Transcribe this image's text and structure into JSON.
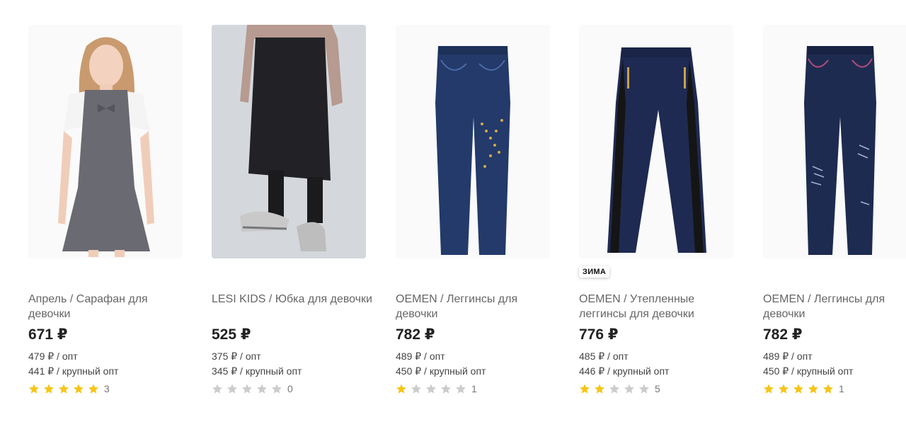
{
  "colors": {
    "star_on": "#f5c518",
    "star_off": "#cccccc"
  },
  "products": [
    {
      "image": "girl-in-gray-sundress-photo",
      "badge": "",
      "title": "Апрель / Сарафан для девочки",
      "price": "671 ₽",
      "opt": "479 ₽ / опт",
      "big_opt": "441 ₽ / крупный опт",
      "rating": 5,
      "reviews": "3"
    },
    {
      "image": "black-skirt-and-sneakers-photo",
      "badge": "",
      "title": "LESI KIDS / Юбка для девочки",
      "price": "525 ₽",
      "opt": "375 ₽ / опт",
      "big_opt": "345 ₽ / крупный опт",
      "rating": 0,
      "reviews": "0"
    },
    {
      "image": "denim-print-leggings-with-studs-photo",
      "badge": "",
      "title": "OEMEN / Леггинсы для девочки",
      "price": "782 ₽",
      "opt": "489 ₽ / опт",
      "big_opt": "450 ₽ / крупный опт",
      "rating": 1,
      "reviews": "1"
    },
    {
      "image": "navy-leggings-with-leather-stripes-photo",
      "badge": "ЗИМА",
      "title": "OEMEN / Утепленные леггинсы для девочки",
      "price": "776 ₽",
      "opt": "485 ₽ / опт",
      "big_opt": "446 ₽ / крупный опт",
      "rating": 2,
      "reviews": "5"
    },
    {
      "image": "distressed-denim-leggings-photo",
      "badge": "",
      "title": "OEMEN / Леггинсы для девочки",
      "price": "782 ₽",
      "opt": "489 ₽ / опт",
      "big_opt": "450 ₽ / крупный опт",
      "rating": 5,
      "reviews": "1"
    }
  ]
}
